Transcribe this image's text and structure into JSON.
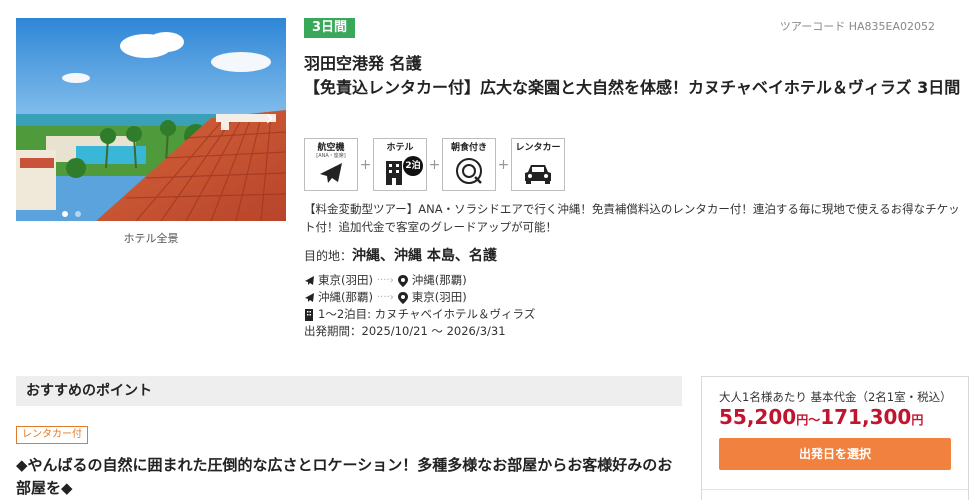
{
  "photo": {
    "caption": "ホテル全景",
    "arrow": "›",
    "dots": 2,
    "active_dot": 0
  },
  "tour": {
    "duration_badge": "3日間",
    "tour_code": "ツアーコード HA835EA02052",
    "title_line1": "羽田空港発 名護",
    "title_line2": "【免責込レンタカー付】広大な楽園と大自然を体感！カヌチャベイホテル＆ヴィラズ 3日間"
  },
  "features": {
    "flight": {
      "label": "航空機",
      "sub": "[ANA・座席]",
      "icon": "airplane-icon"
    },
    "hotel": {
      "label": "ホテル",
      "nights": "2泊",
      "icon": "hotel-building-icon"
    },
    "breakfast": {
      "label": "朝食付き",
      "icon": "breakfast-plate-icon"
    },
    "rental_car": {
      "label": "レンタカー",
      "icon": "car-icon"
    },
    "plus": "+"
  },
  "description": "【料金変動型ツアー】ANA・ソラシドエアで行く沖縄！免責補償料込のレンタカー付！連泊する毎に現地で使えるお得なチケット付！追加代金で客室のグレードアップが可能！",
  "destination": {
    "label": "目的地：",
    "value": "沖縄、沖縄 本島、名護"
  },
  "itinerary": {
    "outbound_from": "東京(羽田)",
    "outbound_to": "沖縄(那覇)",
    "return_from": "沖縄(那覇)",
    "return_to": "東京(羽田)",
    "arrow": "····›",
    "hotel": "1〜2泊目: カヌチャベイホテル＆ヴィラズ",
    "period": "出発期間：2025/10/21 〜 2026/3/31"
  },
  "recommend": {
    "header": "おすすめのポイント",
    "tag": "レンタカー付",
    "body": "◆やんばるの自然に囲まれた圧倒的な広さとロケーション！多種多様なお部屋からお客様好みのお部屋を◆"
  },
  "price": {
    "label": "大人1名様あたり 基本代金（2名1室・税込）",
    "min": "55,200",
    "unit1": "円",
    "tilde": "〜",
    "max": "171,300",
    "unit2": "円",
    "button": "出発日を選択"
  },
  "colors": {
    "badge_green": "#3aa85a",
    "price_red": "#c0152f",
    "button_orange": "#f0813e",
    "tag_orange": "#e07b2a"
  }
}
